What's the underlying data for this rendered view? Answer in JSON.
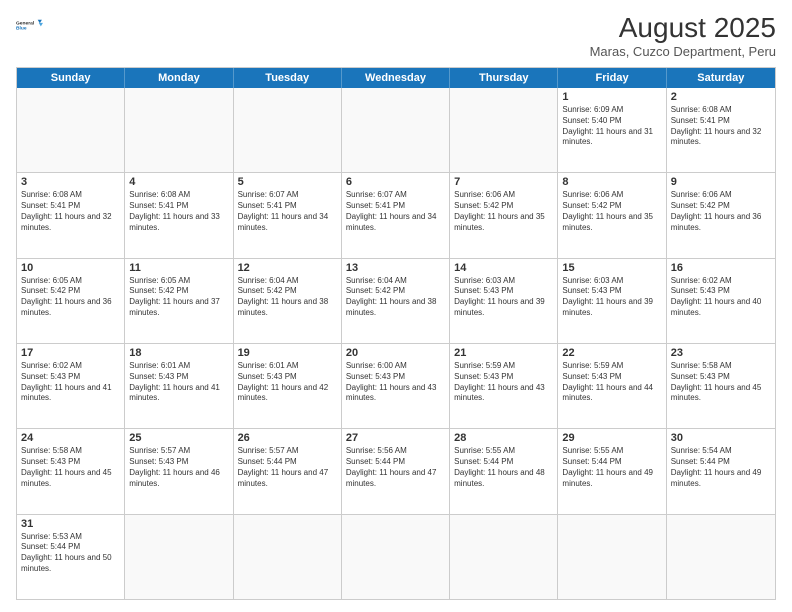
{
  "logo": {
    "line1": "General",
    "line2": "Blue"
  },
  "title": "August 2025",
  "subtitle": "Maras, Cuzco Department, Peru",
  "days_of_week": [
    "Sunday",
    "Monday",
    "Tuesday",
    "Wednesday",
    "Thursday",
    "Friday",
    "Saturday"
  ],
  "weeks": [
    [
      {
        "day": "",
        "empty": true
      },
      {
        "day": "",
        "empty": true
      },
      {
        "day": "",
        "empty": true
      },
      {
        "day": "",
        "empty": true
      },
      {
        "day": "",
        "empty": true
      },
      {
        "day": "1",
        "sunrise": "6:09 AM",
        "sunset": "5:40 PM",
        "daylight": "11 hours and 31 minutes."
      },
      {
        "day": "2",
        "sunrise": "6:08 AM",
        "sunset": "5:41 PM",
        "daylight": "11 hours and 32 minutes."
      }
    ],
    [
      {
        "day": "3",
        "sunrise": "6:08 AM",
        "sunset": "5:41 PM",
        "daylight": "11 hours and 32 minutes."
      },
      {
        "day": "4",
        "sunrise": "6:08 AM",
        "sunset": "5:41 PM",
        "daylight": "11 hours and 33 minutes."
      },
      {
        "day": "5",
        "sunrise": "6:07 AM",
        "sunset": "5:41 PM",
        "daylight": "11 hours and 34 minutes."
      },
      {
        "day": "6",
        "sunrise": "6:07 AM",
        "sunset": "5:41 PM",
        "daylight": "11 hours and 34 minutes."
      },
      {
        "day": "7",
        "sunrise": "6:06 AM",
        "sunset": "5:42 PM",
        "daylight": "11 hours and 35 minutes."
      },
      {
        "day": "8",
        "sunrise": "6:06 AM",
        "sunset": "5:42 PM",
        "daylight": "11 hours and 35 minutes."
      },
      {
        "day": "9",
        "sunrise": "6:06 AM",
        "sunset": "5:42 PM",
        "daylight": "11 hours and 36 minutes."
      }
    ],
    [
      {
        "day": "10",
        "sunrise": "6:05 AM",
        "sunset": "5:42 PM",
        "daylight": "11 hours and 36 minutes."
      },
      {
        "day": "11",
        "sunrise": "6:05 AM",
        "sunset": "5:42 PM",
        "daylight": "11 hours and 37 minutes."
      },
      {
        "day": "12",
        "sunrise": "6:04 AM",
        "sunset": "5:42 PM",
        "daylight": "11 hours and 38 minutes."
      },
      {
        "day": "13",
        "sunrise": "6:04 AM",
        "sunset": "5:42 PM",
        "daylight": "11 hours and 38 minutes."
      },
      {
        "day": "14",
        "sunrise": "6:03 AM",
        "sunset": "5:43 PM",
        "daylight": "11 hours and 39 minutes."
      },
      {
        "day": "15",
        "sunrise": "6:03 AM",
        "sunset": "5:43 PM",
        "daylight": "11 hours and 39 minutes."
      },
      {
        "day": "16",
        "sunrise": "6:02 AM",
        "sunset": "5:43 PM",
        "daylight": "11 hours and 40 minutes."
      }
    ],
    [
      {
        "day": "17",
        "sunrise": "6:02 AM",
        "sunset": "5:43 PM",
        "daylight": "11 hours and 41 minutes."
      },
      {
        "day": "18",
        "sunrise": "6:01 AM",
        "sunset": "5:43 PM",
        "daylight": "11 hours and 41 minutes."
      },
      {
        "day": "19",
        "sunrise": "6:01 AM",
        "sunset": "5:43 PM",
        "daylight": "11 hours and 42 minutes."
      },
      {
        "day": "20",
        "sunrise": "6:00 AM",
        "sunset": "5:43 PM",
        "daylight": "11 hours and 43 minutes."
      },
      {
        "day": "21",
        "sunrise": "5:59 AM",
        "sunset": "5:43 PM",
        "daylight": "11 hours and 43 minutes."
      },
      {
        "day": "22",
        "sunrise": "5:59 AM",
        "sunset": "5:43 PM",
        "daylight": "11 hours and 44 minutes."
      },
      {
        "day": "23",
        "sunrise": "5:58 AM",
        "sunset": "5:43 PM",
        "daylight": "11 hours and 45 minutes."
      }
    ],
    [
      {
        "day": "24",
        "sunrise": "5:58 AM",
        "sunset": "5:43 PM",
        "daylight": "11 hours and 45 minutes."
      },
      {
        "day": "25",
        "sunrise": "5:57 AM",
        "sunset": "5:43 PM",
        "daylight": "11 hours and 46 minutes."
      },
      {
        "day": "26",
        "sunrise": "5:57 AM",
        "sunset": "5:44 PM",
        "daylight": "11 hours and 47 minutes."
      },
      {
        "day": "27",
        "sunrise": "5:56 AM",
        "sunset": "5:44 PM",
        "daylight": "11 hours and 47 minutes."
      },
      {
        "day": "28",
        "sunrise": "5:55 AM",
        "sunset": "5:44 PM",
        "daylight": "11 hours and 48 minutes."
      },
      {
        "day": "29",
        "sunrise": "5:55 AM",
        "sunset": "5:44 PM",
        "daylight": "11 hours and 49 minutes."
      },
      {
        "day": "30",
        "sunrise": "5:54 AM",
        "sunset": "5:44 PM",
        "daylight": "11 hours and 49 minutes."
      }
    ],
    [
      {
        "day": "31",
        "sunrise": "5:53 AM",
        "sunset": "5:44 PM",
        "daylight": "11 hours and 50 minutes."
      },
      {
        "day": "",
        "empty": true
      },
      {
        "day": "",
        "empty": true
      },
      {
        "day": "",
        "empty": true
      },
      {
        "day": "",
        "empty": true
      },
      {
        "day": "",
        "empty": true
      },
      {
        "day": "",
        "empty": true
      }
    ]
  ],
  "labels": {
    "sunrise": "Sunrise:",
    "sunset": "Sunset:",
    "daylight": "Daylight:"
  }
}
